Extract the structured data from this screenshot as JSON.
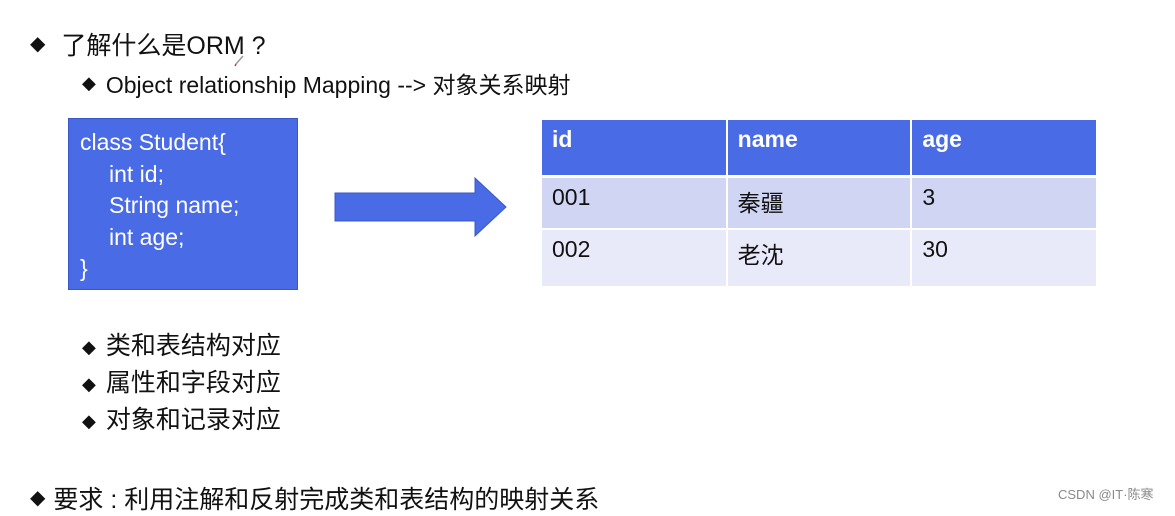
{
  "slide": {
    "heading": {
      "bullet_icon": "diamond-bullet",
      "text": "了解什么是ORM ?"
    },
    "subheading": {
      "bullet_icon": "diamond-bullet",
      "text": "Object relationship Mapping --> 对象关系映射"
    },
    "class_box": {
      "lines": [
        "class Student{",
        "int id;",
        "String name;",
        "int age;",
        "}"
      ],
      "color": "#4a6be6"
    },
    "arrow": {
      "icon": "right-arrow",
      "color": "#4a6be6"
    },
    "table": {
      "headers": [
        "id",
        "name",
        "age"
      ],
      "rows": [
        [
          "001",
          "秦疆",
          "3"
        ],
        [
          "002",
          "老沈",
          "30"
        ]
      ],
      "header_color": "#4a6be6",
      "row_colors": [
        "#d0d5f3",
        "#e8eafa"
      ]
    },
    "points": [
      "类和表结构对应",
      "属性和字段对应",
      "对象和记录对应"
    ],
    "requirement": "要求 : 利用注解和反射完成类和表结构的映射关系",
    "watermark": "CSDN @IT·陈寒"
  }
}
